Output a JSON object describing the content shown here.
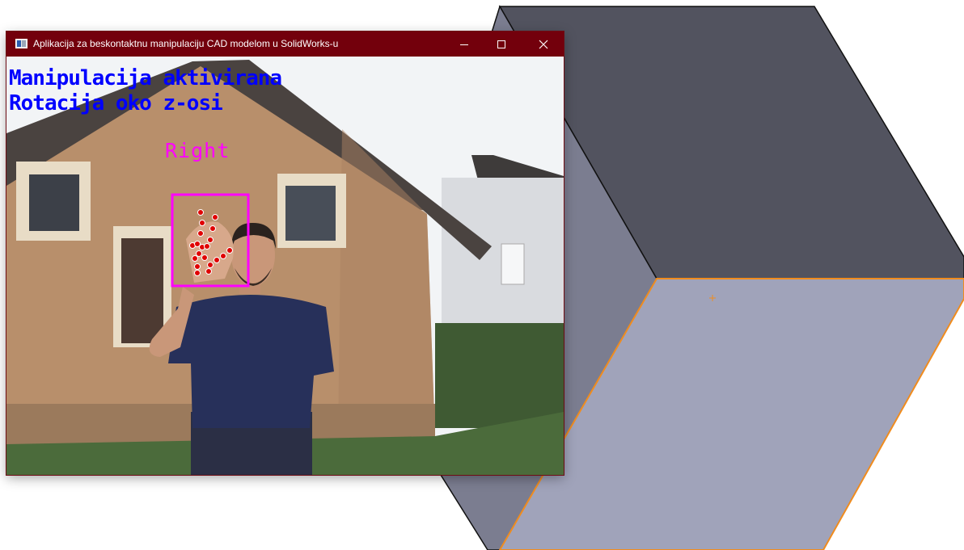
{
  "window": {
    "title": "Aplikacija za beskontaktnu manipulaciju CAD modelom u SolidWorks-u",
    "minimize_label": "minimize",
    "maximize_label": "maximize",
    "close_label": "close"
  },
  "overlay": {
    "status_line1": "Manipulacija aktivirana",
    "status_line2": "Rotacija oko z-osi",
    "hand_label": "Right"
  },
  "colors": {
    "title_bar": "#73000c",
    "status_text": "#0000ff",
    "hand_box": "#ff00ff",
    "landmark": "#e00000",
    "cube_top": "#52535f",
    "cube_left": "#7b7d90",
    "cube_front": "#a0a3ba",
    "selection_edge": "#f08c1e"
  }
}
